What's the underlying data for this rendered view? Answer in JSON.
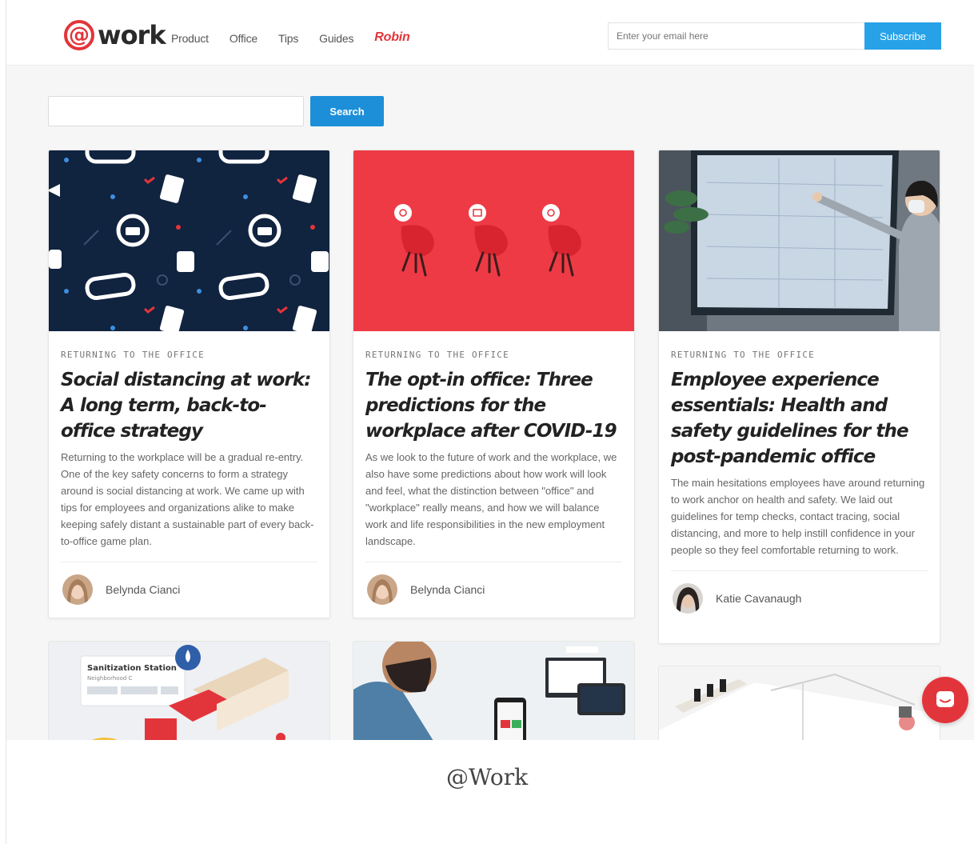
{
  "header": {
    "logo_text": "work",
    "logo_symbol": "@",
    "nav": [
      {
        "label": "Product"
      },
      {
        "label": "Office"
      },
      {
        "label": "Tips"
      },
      {
        "label": "Guides"
      },
      {
        "label": "Robin"
      }
    ],
    "email_placeholder": "Enter your email here",
    "subscribe_label": "Subscribe"
  },
  "search": {
    "button_label": "Search"
  },
  "cards": [
    {
      "category": "RETURNING TO THE OFFICE",
      "title": "Social distancing at work: A long term, back-to-office strategy",
      "excerpt": "Returning to the workplace will be a gradual re-entry. One of the key safety concerns to form a strategy around is social distancing at work. We came up with tips for employees and organizations alike to make keeping safely distant a sustainable part of every back-to-office game plan.",
      "author": "Belynda Cianci"
    },
    {
      "category": "RETURNING TO THE OFFICE",
      "title": "The opt-in office: Three predictions for the workplace after COVID-19",
      "excerpt": "As we look to the future of work and the workplace, we also have some predictions about how work will look and feel, what the distinction between \"office\" and \"workplace\" really means, and how we will balance work and life responsibilities in the new employment landscape.",
      "author": "Belynda Cianci"
    },
    {
      "category": "RETURNING TO THE OFFICE",
      "title": "Employee experience essentials: Health and safety guidelines for the post-pandemic office",
      "excerpt": "The main hesitations employees have around returning to work anchor on health and safety. We laid out guidelines for temp checks, contact tracing, social distancing, and more to help instill confidence in your people so they feel comfortable returning to work.",
      "author": "Katie Cavanaugh"
    }
  ],
  "bottom_cards": {
    "sanitization_title": "Sanitization Station",
    "sanitization_sub": "Neighborhood C"
  },
  "caption": "@Work",
  "colors": {
    "brand_red": "#e2353b",
    "subscribe_blue": "#27a2e8",
    "search_blue": "#1d8fd9",
    "card1_bg": "#10233f",
    "card2_bg": "#ee3a45"
  }
}
